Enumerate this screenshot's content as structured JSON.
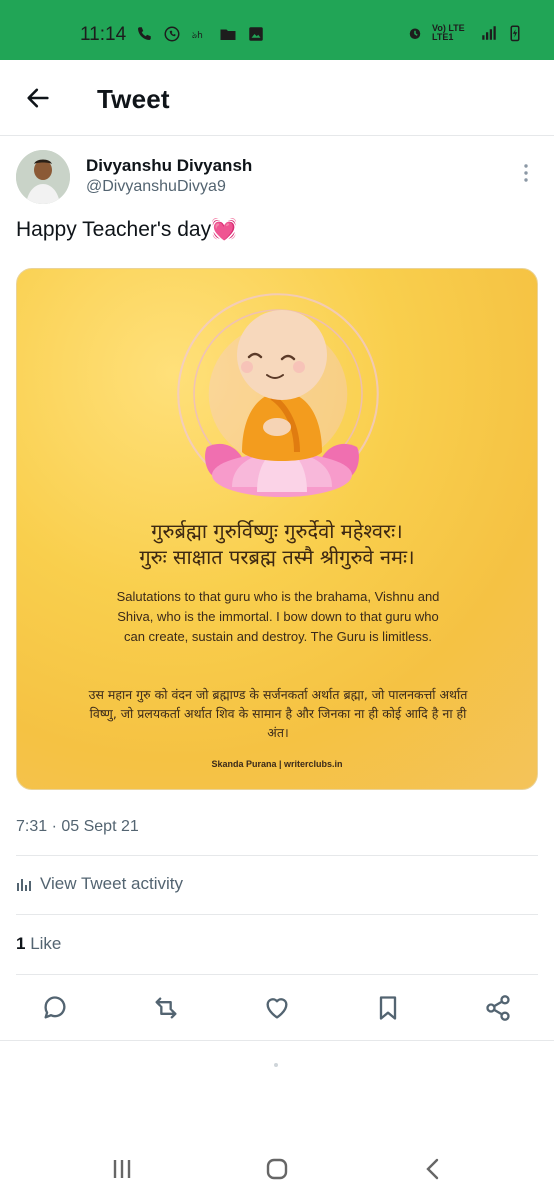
{
  "status_bar": {
    "time": "11:14",
    "network": "Vo) LTE LTE1"
  },
  "header": {
    "title": "Tweet"
  },
  "tweet": {
    "author_name": "Divyanshu Divyansh",
    "author_handle": "@DivyanshuDivya9",
    "text": "Happy Teacher's day💓",
    "timestamp": "7:31 · 05 Sept 21",
    "view_activity": "View Tweet activity",
    "likes_count": "1",
    "likes_label": "Like"
  },
  "media": {
    "sanskrit_line1": "गुरुर्ब्रह्मा गुरुर्विष्णुः गुरुर्देवो महेश्वरः।",
    "sanskrit_line2": "गुरुः साक्षात परब्रह्म तस्मै श्रीगुरुवे नमः।",
    "english_text": "Salutations to that guru who is the brahama, Vishnu and Shiva, who is the immortal. I bow down to that guru who can create, sustain and destroy. The Guru is limitless.",
    "hindi_text": "उस महान गुरु को वंदन जो ब्रह्माण्ड के सर्जनकर्ता अर्थात ब्रह्मा, जो पालनकर्त्ता अर्थात विष्णु, जो प्रलयकर्ता अर्थात शिव के सामान है और जिनका ना ही कोई आदि है ना ही अंत।",
    "credit": "Skanda Purana | writerclubs.in"
  },
  "colors": {
    "status_bar": "#21a556",
    "text_primary": "#0f1419",
    "text_secondary": "#536471",
    "divider": "#e6e8ea",
    "media_bg": "#f9cf4d"
  }
}
